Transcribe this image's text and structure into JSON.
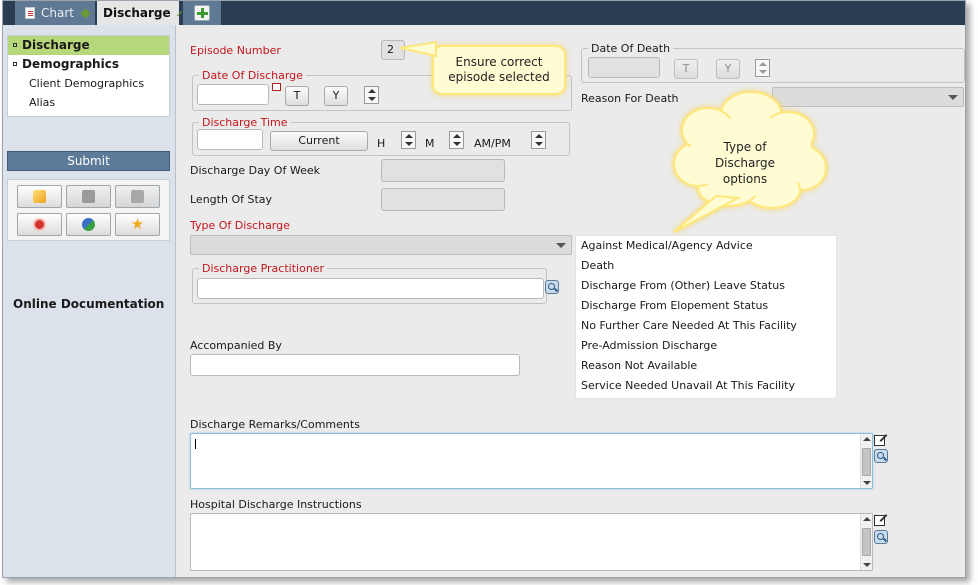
{
  "tabs": [
    {
      "label": "Chart"
    },
    {
      "label": "Discharge"
    }
  ],
  "sidebar": {
    "items": [
      {
        "label": "Discharge"
      },
      {
        "label": "Demographics"
      }
    ],
    "subitems": [
      "Client Demographics",
      "Alias"
    ],
    "submit_label": "Submit",
    "online_doc": "Online Documentation"
  },
  "episode": {
    "label": "Episode Number",
    "value": "2"
  },
  "date_of_death": {
    "label": "Date Of Death",
    "t_label": "T",
    "y_label": "Y"
  },
  "reason_for_death": {
    "label": "Reason For Death"
  },
  "date_of_discharge": {
    "label": "Date Of Discharge",
    "t_label": "T",
    "y_label": "Y"
  },
  "discharge_time": {
    "label": "Discharge Time",
    "current_label": "Current",
    "h_label": "H",
    "m_label": "M",
    "ampm_label": "AM/PM"
  },
  "day_of_week": {
    "label": "Discharge Day Of Week"
  },
  "length_of_stay": {
    "label": "Length Of Stay"
  },
  "type_of_discharge": {
    "label": "Type Of Discharge",
    "options": [
      "Against Medical/Agency Advice",
      "Death",
      "Discharge From (Other) Leave Status",
      "Discharge From Elopement Status",
      "No Further Care Needed At This Facility",
      "Pre-Admission Discharge",
      "Reason Not Available",
      "Service Needed Unavail At This Facility"
    ]
  },
  "discharge_practitioner": {
    "label": "Discharge Practitioner"
  },
  "accompanied_by": {
    "label": "Accompanied By"
  },
  "remarks": {
    "label": "Discharge Remarks/Comments"
  },
  "instructions": {
    "label": "Hospital Discharge Instructions"
  },
  "callouts": {
    "episode": "Ensure correct episode selected",
    "type": "Type of Discharge options"
  },
  "colors": {
    "tabbar": "#2b3d52",
    "nav_selected": "#b6d77a",
    "submit": "#5d7a99",
    "required_label": "#c4161c",
    "callout_fill": "#fffbd3",
    "callout_border": "#ffe77a"
  }
}
